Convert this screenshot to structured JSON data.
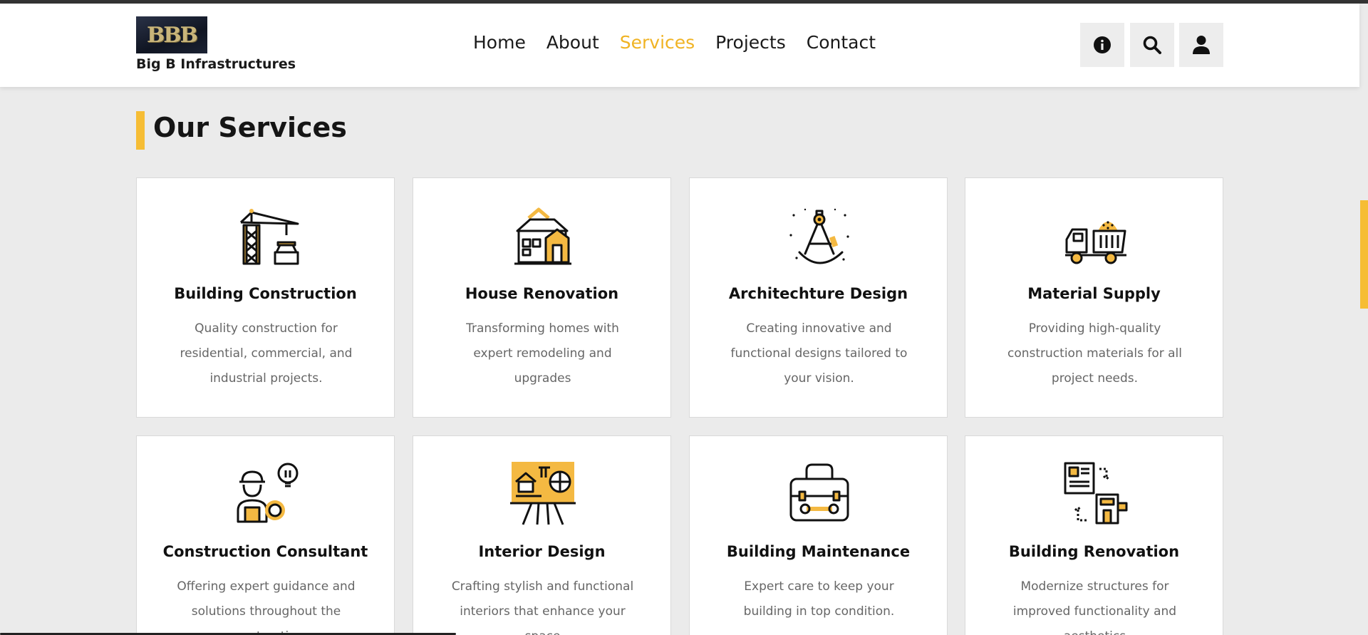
{
  "brand": {
    "logo_text": "BBB",
    "name": "Big B Infrastructures"
  },
  "nav": {
    "items": [
      {
        "label": "Home",
        "active": false
      },
      {
        "label": "About",
        "active": false
      },
      {
        "label": "Services",
        "active": true
      },
      {
        "label": "Projects",
        "active": false
      },
      {
        "label": "Contact",
        "active": false
      }
    ]
  },
  "header_icons": [
    "info-icon",
    "search-icon",
    "user-icon"
  ],
  "section": {
    "title": "Our Services"
  },
  "services": [
    {
      "title": "Building Construction",
      "description": "Quality construction for residential, commercial, and industrial projects.",
      "icon": "crane-icon"
    },
    {
      "title": "House Renovation",
      "description": "Transforming homes with expert remodeling and upgrades",
      "icon": "house-icon"
    },
    {
      "title": "Architechture Design",
      "description": "Creating innovative and functional designs tailored to your vision.",
      "icon": "compass-icon"
    },
    {
      "title": "Material Supply",
      "description": "Providing high-quality construction materials for all project needs.",
      "icon": "truck-icon"
    },
    {
      "title": "Construction Consultant",
      "description": "Offering expert guidance and solutions throughout the construction",
      "icon": "consultant-icon"
    },
    {
      "title": "Interior Design",
      "description": "Crafting stylish and functional interiors that enhance your space",
      "icon": "easel-icon"
    },
    {
      "title": "Building Maintenance",
      "description": "Expert care to keep your building in top condition.",
      "icon": "toolbox-icon"
    },
    {
      "title": "Building Renovation",
      "description": "Modernize structures for improved functionality and aesthetics",
      "icon": "renovation-icon"
    }
  ],
  "colors": {
    "accent": "#f6bd35",
    "nav_active": "#f0b323",
    "background": "#ebebeb"
  }
}
